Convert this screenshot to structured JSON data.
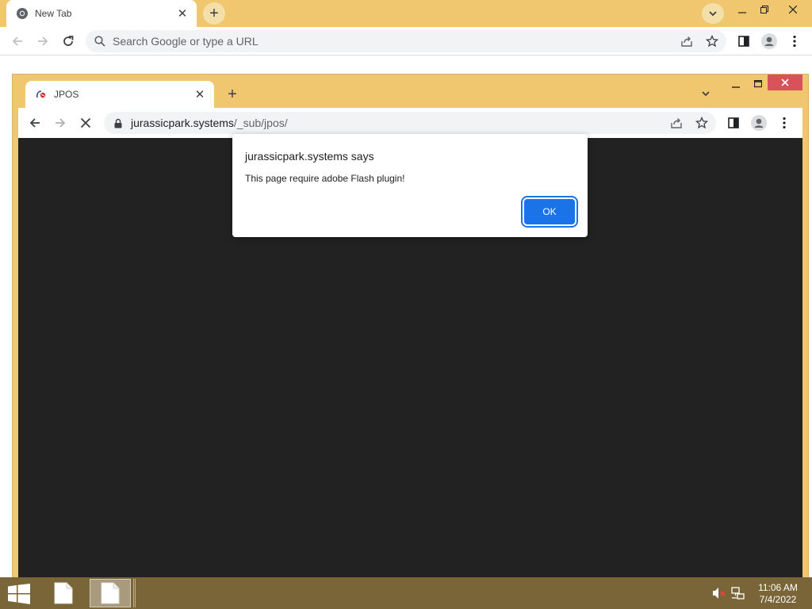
{
  "outer_browser": {
    "tab": {
      "title": "New Tab",
      "close": "✕"
    },
    "new_tab": "+",
    "omnibox": {
      "placeholder": "Search Google or type a URL"
    }
  },
  "inner_browser": {
    "tab": {
      "title": "JPOS",
      "close": "✕"
    },
    "new_tab": "+",
    "address": {
      "domain": "jurassicpark.systems",
      "path": "/_sub/jpos/"
    }
  },
  "alert": {
    "title": "jurassicpark.systems says",
    "message": "This page require adobe Flash plugin!",
    "ok_label": "OK"
  },
  "taskbar": {
    "clock_time": "11:06 AM",
    "clock_date": "7/4/2022"
  },
  "colors": {
    "tabstrip": "#f0c76e",
    "taskbar": "#7a6538",
    "page_background": "#222222",
    "accent_button": "#1a73e8",
    "close_button": "#d8525a"
  },
  "icons": {
    "outer": [
      "chrome-icon",
      "close-icon",
      "plus-icon",
      "chevron-down-icon",
      "minimize-icon",
      "maximize-icon",
      "close-icon",
      "back-icon",
      "forward-icon",
      "reload-icon",
      "search-icon",
      "share-icon",
      "star-icon",
      "side-panel-icon",
      "profile-icon",
      "menu-icon"
    ],
    "inner": [
      "site-favicon",
      "close-icon",
      "plus-icon",
      "chevron-down-icon",
      "minimize-icon",
      "maximize-icon",
      "close-icon",
      "back-icon",
      "forward-icon",
      "stop-icon",
      "lock-icon",
      "share-icon",
      "star-icon",
      "side-panel-icon",
      "profile-icon",
      "menu-icon"
    ],
    "taskbar": [
      "windows-start-icon",
      "file-icon",
      "file-icon",
      "volume-muted-icon",
      "network-icon"
    ]
  }
}
